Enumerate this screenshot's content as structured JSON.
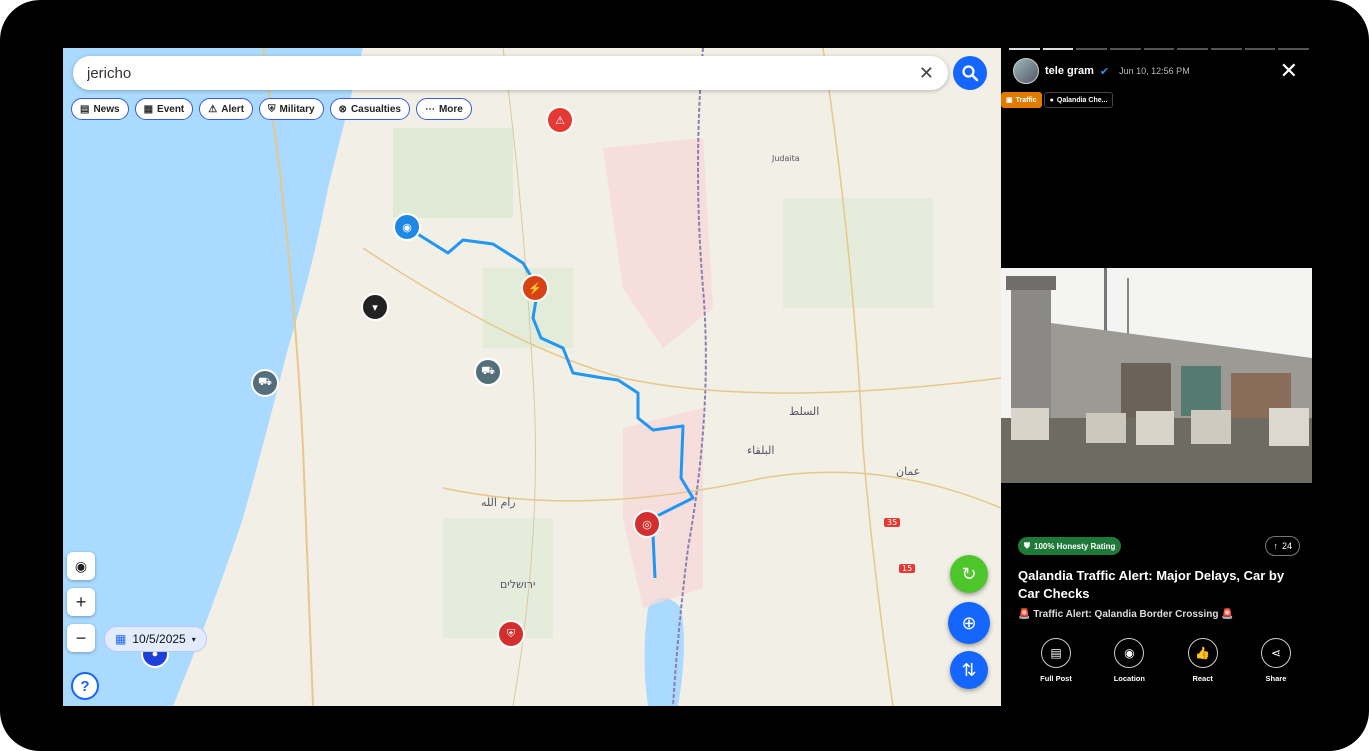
{
  "search": {
    "value": "jericho",
    "clear_icon": "close-icon",
    "search_icon": "search-icon"
  },
  "filters": [
    {
      "label": "News",
      "icon": "news-icon"
    },
    {
      "label": "Event",
      "icon": "calendar-icon"
    },
    {
      "label": "Alert",
      "icon": "warning-icon"
    },
    {
      "label": "Military",
      "icon": "shield-icon"
    },
    {
      "label": "Casualties",
      "icon": "casualties-icon"
    },
    {
      "label": "More",
      "icon": "more-icon"
    }
  ],
  "map_controls": {
    "zoom_in": "+",
    "zoom_out": "−",
    "date": "10/5/2025",
    "help": "?"
  },
  "map_labels": {
    "city_ramallah": "رام الله",
    "city_jerusalem": "ירושלים",
    "city_amman": "عمان",
    "city_salt": "السلط",
    "city_balqa": "البلقاء",
    "city_judaita": "Judaita",
    "road_35": "35",
    "road_15": "15"
  },
  "post": {
    "author": "tele gram",
    "verified_icon": "verified-icon",
    "timestamp": "Jun 10, 12:56 PM",
    "tags": [
      {
        "label": "Traffic",
        "color": "#e07b00"
      },
      {
        "label": "Qalandia Che...",
        "color": "#000000"
      }
    ],
    "honesty": "100% Honesty Rating",
    "upvotes": "24",
    "title": "Qalandia Traffic Alert: Major Delays, Car by Car Checks",
    "subtitle": "🚨 Traffic Alert: Qalandia Border Crossing 🚨",
    "actions": [
      {
        "label": "Full Post",
        "icon": "document-icon"
      },
      {
        "label": "Location",
        "icon": "location-pin-icon"
      },
      {
        "label": "React",
        "icon": "thumbs-up-icon"
      },
      {
        "label": "Share",
        "icon": "share-icon"
      }
    ]
  },
  "colors": {
    "accent": "#1565ff",
    "refresh": "#4cc62a",
    "route": "#2196f3"
  }
}
